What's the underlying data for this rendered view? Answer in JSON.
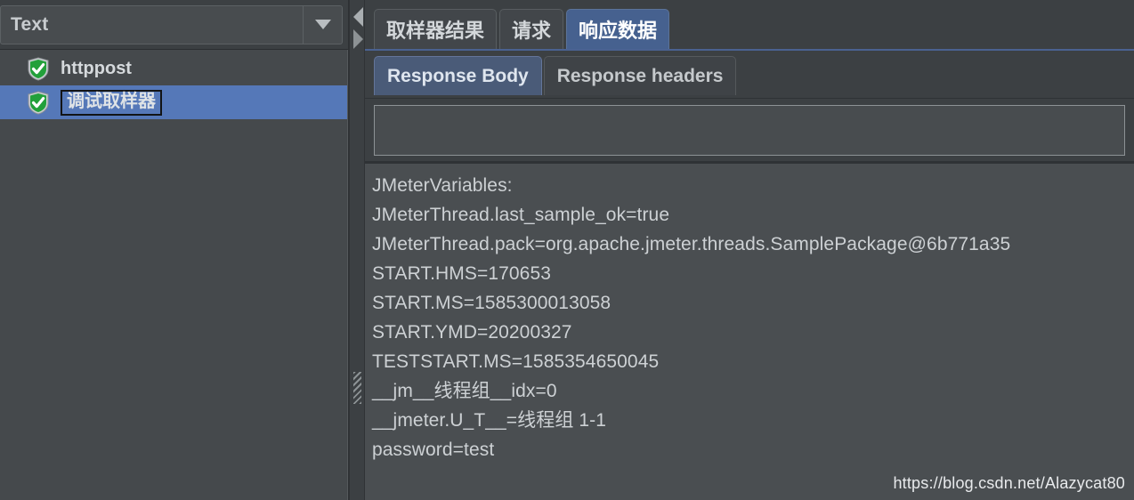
{
  "left_panel": {
    "combo": {
      "name": "render-type-combo",
      "value": "Text",
      "arrow_icon": "chevron-down-icon"
    },
    "tree": {
      "nodes": [
        {
          "label": "httppost",
          "icon": "green-shield-check-icon",
          "selected": false,
          "editing": false
        },
        {
          "label": "调试取样器",
          "icon": "green-shield-check-icon",
          "selected": true,
          "editing": true
        }
      ]
    }
  },
  "splitter": {
    "collapse_left_icon": "triangle-left-icon",
    "collapse_right_icon": "triangle-right-icon",
    "grip_icon": "splitter-grip-icon"
  },
  "right_panel": {
    "tabs": [
      {
        "label": "取样器结果",
        "active": false
      },
      {
        "label": "请求",
        "active": false
      },
      {
        "label": "响应数据",
        "active": true
      }
    ],
    "subtabs": [
      {
        "label": "Response Body",
        "active": true
      },
      {
        "label": "Response headers",
        "active": false
      }
    ],
    "search": {
      "value": "",
      "placeholder": ""
    },
    "response_body": {
      "lines": [
        "JMeterVariables:",
        "JMeterThread.last_sample_ok=true",
        "JMeterThread.pack=org.apache.jmeter.threads.SamplePackage@6b771a35",
        "START.HMS=170653",
        "START.MS=1585300013058",
        "START.YMD=20200327",
        "TESTSTART.MS=1585354650045",
        "__jm__线程组__idx=0",
        "__jmeter.U_T__=线程组 1-1",
        "password=test"
      ]
    }
  },
  "watermark": {
    "text": "https://blog.csdn.net/Alazycat80"
  },
  "colors": {
    "window_bg": "#3c4043",
    "panel_bg": "#45494c",
    "selection_blue": "#5578b8",
    "active_tab_blue": "#46618f",
    "active_subtab_blue": "#4a5b78",
    "response_bg": "#4a4e51",
    "text_primary": "#cdd1d4",
    "shield_green": "#22a03a"
  }
}
